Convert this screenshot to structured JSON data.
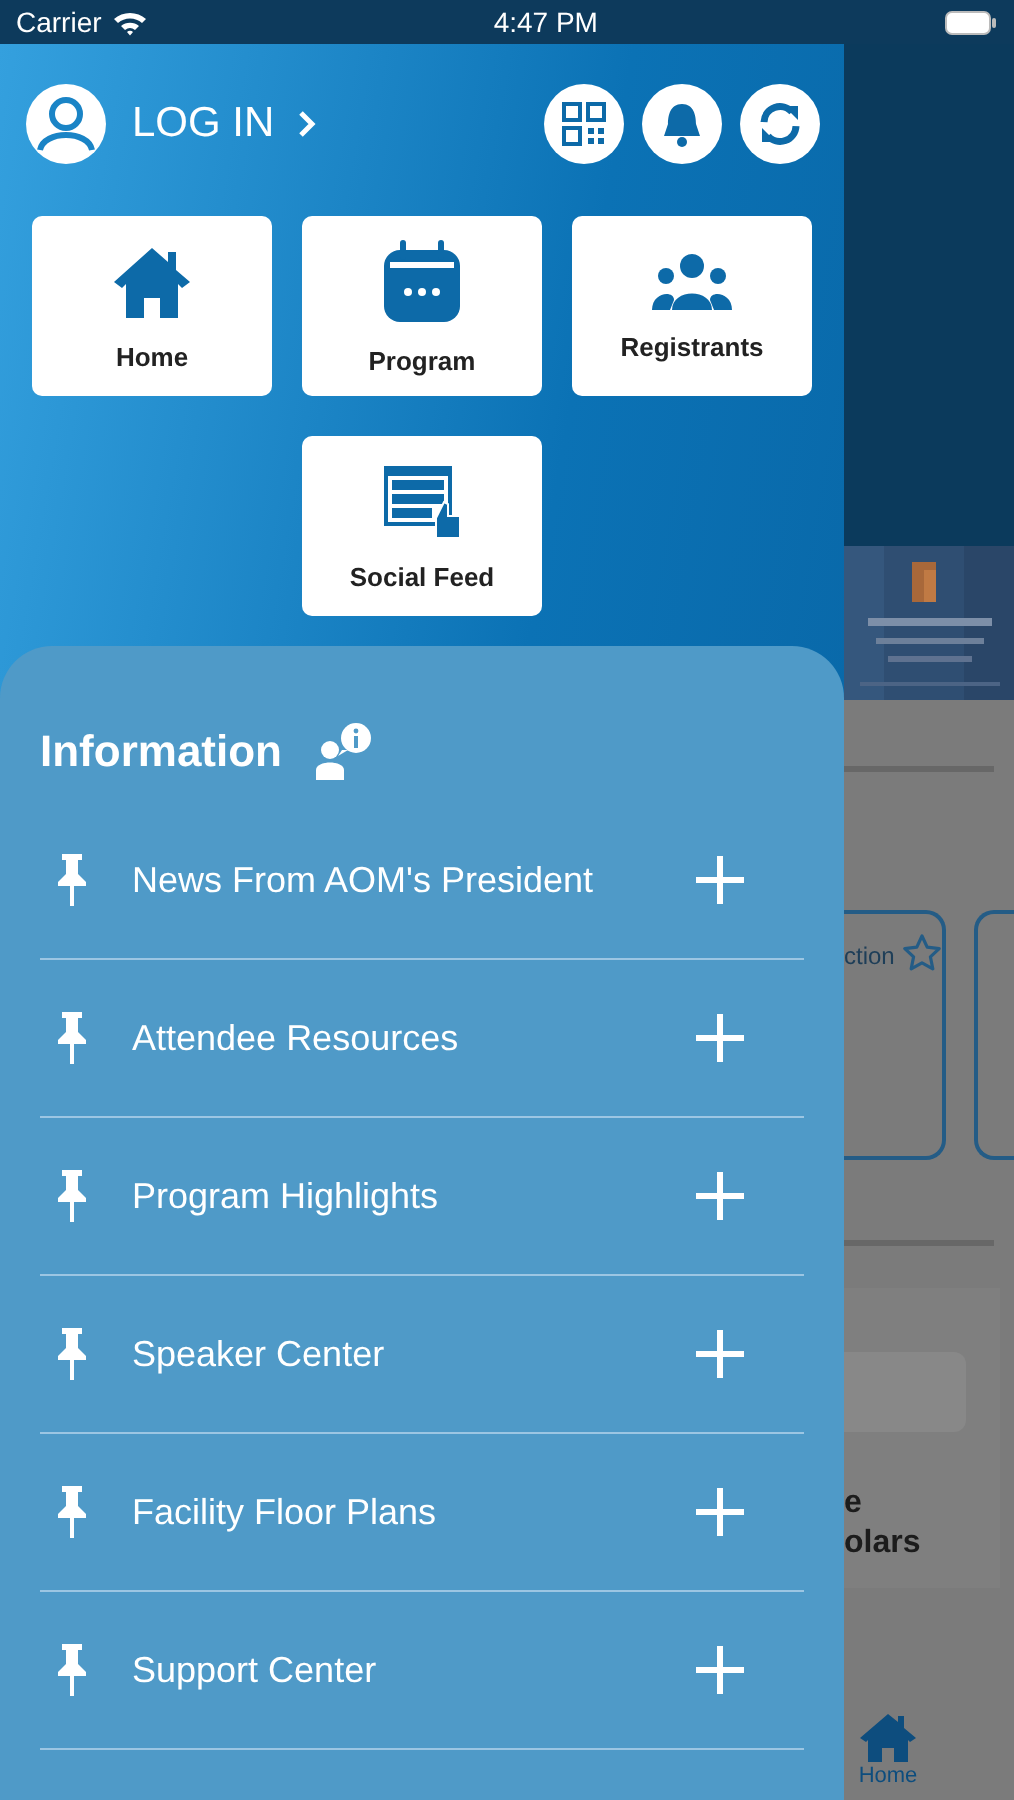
{
  "status_bar": {
    "carrier": "Carrier",
    "time": "4:47 PM"
  },
  "drawer": {
    "login": "LOG IN",
    "header_buttons": [
      {
        "kind": "qr"
      },
      {
        "kind": "bell"
      },
      {
        "kind": "refresh"
      }
    ],
    "tiles": [
      {
        "kind": "home",
        "label": "Home"
      },
      {
        "kind": "calendar",
        "label": "Program"
      },
      {
        "kind": "people",
        "label": "Registrants"
      },
      {
        "kind": "feed",
        "label": "Social Feed"
      }
    ],
    "information": {
      "title": "Information",
      "items": [
        {
          "label": "News From AOM's President"
        },
        {
          "label": "Attendee Resources"
        },
        {
          "label": "Program Highlights"
        },
        {
          "label": "Speaker Center"
        },
        {
          "label": "Facility Floor Plans"
        },
        {
          "label": "Support Center"
        }
      ]
    }
  },
  "background": {
    "card_text": "ction",
    "text_lines": [
      "e",
      "olars"
    ],
    "tab": {
      "label": "Home",
      "selected": true
    }
  }
}
